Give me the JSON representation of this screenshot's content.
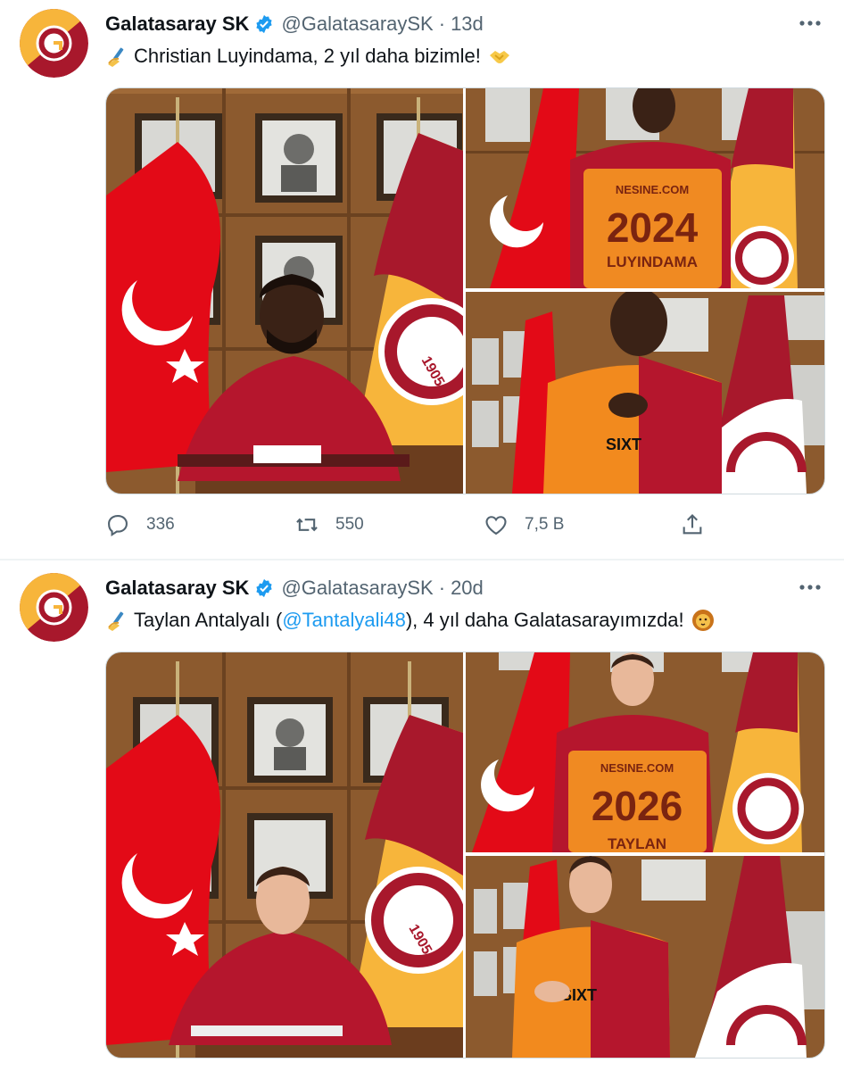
{
  "tweets": [
    {
      "author_name": "Galatasaray SK",
      "author_handle": "@GalatasaraySK",
      "separator": "·",
      "time": "13d",
      "text_before": "Christian Luyindama, 2 yıl daha bizimle!",
      "mention": "",
      "text_after": "",
      "leading_emoji": "writing-hand-icon",
      "trailing_emoji": "handshake-icon",
      "jersey_year": "2024",
      "jersey_sponsor": "NESINE.COM",
      "jersey_name": "LUYINDAMA",
      "crest_year": "1905",
      "shirt_sponsor": "SIXT",
      "replies": "336",
      "retweets": "550",
      "likes": "7,5 B"
    },
    {
      "author_name": "Galatasaray SK",
      "author_handle": "@GalatasaraySK",
      "separator": "·",
      "time": "20d",
      "text_before": "Taylan Antalyalı (",
      "mention": "@Tantalyali48",
      "text_after": "), 4 yıl daha Galatasarayımızda!",
      "leading_emoji": "writing-hand-icon",
      "trailing_emoji": "lion-face-icon",
      "jersey_year": "2026",
      "jersey_sponsor": "NESINE.COM",
      "jersey_name": "TAYLAN",
      "crest_year": "1905",
      "shirt_sponsor": "SIXT"
    }
  ],
  "colors": {
    "accent": "#1d9bf0",
    "muted": "#536471",
    "club_red": "#a8182c",
    "club_yellow": "#f7b53b",
    "flag_red": "#e30a17"
  }
}
